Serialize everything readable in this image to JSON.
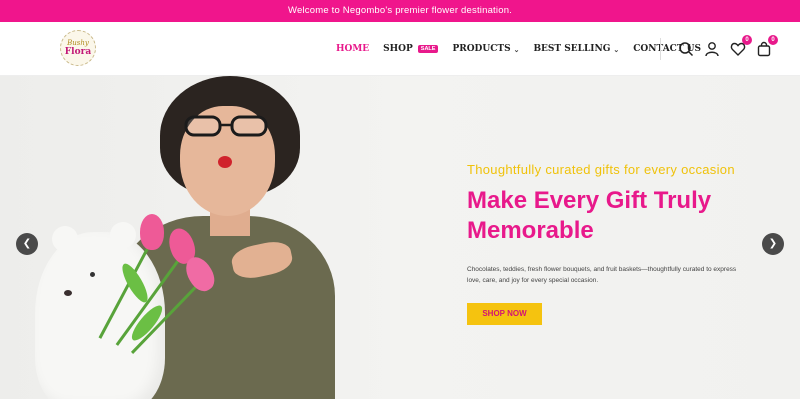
{
  "announcement": "Welcome to Negombo's premier flower destination.",
  "logo": {
    "line1": "Bushy",
    "line2": "Flora"
  },
  "nav": {
    "home": "HOME",
    "shop": "SHOP",
    "shop_badge": "SALE",
    "products": "PRODUCTS",
    "best_selling": "BEST SELLING",
    "contact": "CONTACT US"
  },
  "header_icons": {
    "search": "search-icon",
    "account": "user-icon",
    "wishlist": "heart-icon",
    "wishlist_count": "0",
    "cart": "bag-icon",
    "cart_count": "0"
  },
  "hero": {
    "tagline": "Thoughtfully curated gifts for every occasion",
    "title": "Make Every Gift Truly Memorable",
    "description": "Chocolates, teddies, fresh flower bouquets, and fruit baskets—thoughtfully curated to express love, care, and joy for every special occasion.",
    "cta": "SHOP NOW",
    "prev_glyph": "❮",
    "next_glyph": "❯"
  },
  "colors": {
    "brand_pink": "#e8198b",
    "accent_yellow": "#f5c30f"
  }
}
